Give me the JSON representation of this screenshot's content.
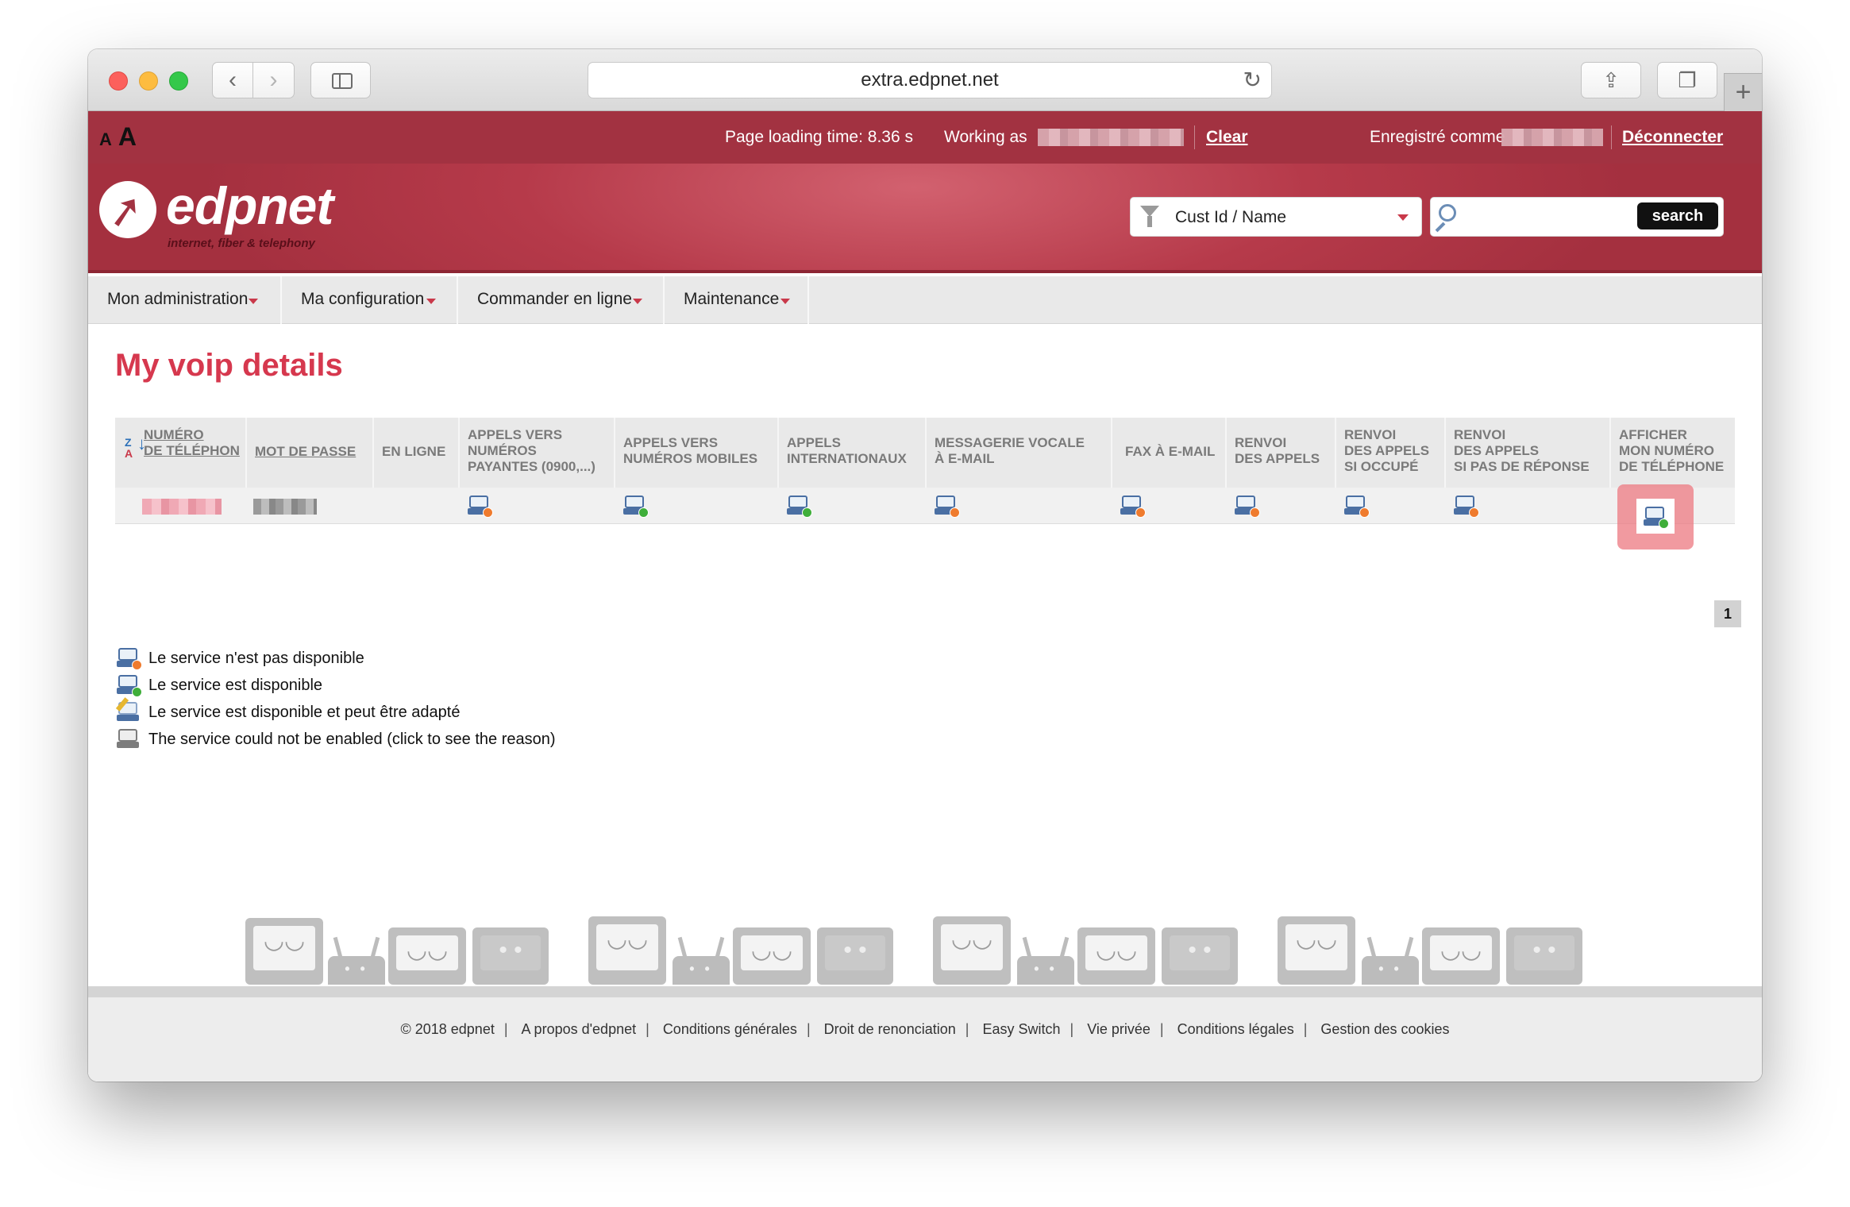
{
  "browser": {
    "url": "extra.edpnet.net",
    "back_icon": "chevron-left-icon",
    "forward_icon": "chevron-right-icon",
    "reload_icon": "reload-icon",
    "share_icon": "share-icon",
    "tabs_icon": "tabs-icon",
    "new_tab_symbol": "+"
  },
  "topbar": {
    "font_small": "A",
    "font_large": "A",
    "loading_time": "Page loading time: 8.36 s",
    "working_as_label": "Working as",
    "clear_link": "Clear",
    "registered_as_label": "Enregistré comme",
    "logout_link": "Déconnecter"
  },
  "brand": {
    "logo_text": "edpnet",
    "tagline": "internet, fiber & telephony",
    "filter_label": "Cust Id / Name",
    "search_placeholder": "",
    "search_button": "search"
  },
  "menu": [
    {
      "label": "Mon administration"
    },
    {
      "label": "Ma configuration"
    },
    {
      "label": "Commander en ligne"
    },
    {
      "label": "Maintenance"
    }
  ],
  "page": {
    "title": "My voip details",
    "pagination_current": "1"
  },
  "table": {
    "headers": [
      [
        "NUMÉRO",
        "DE TÉLÉPHON"
      ],
      [
        "MOT DE PASSE"
      ],
      [
        "EN LIGNE"
      ],
      [
        "APPELS VERS",
        "NUMÉROS",
        "PAYANTES (0900,...)"
      ],
      [
        "APPELS VERS",
        "NUMÉROS MOBILES"
      ],
      [
        "APPELS",
        "INTERNATIONAUX"
      ],
      [
        "MESSAGERIE VOCALE",
        "À E-MAIL"
      ],
      [
        "FAX À E-MAIL"
      ],
      [
        "RENVOI",
        "DES APPELS"
      ],
      [
        "RENVOI",
        "DES APPELS",
        "SI OCCUPÉ"
      ],
      [
        "RENVOI",
        "DES APPELS",
        "SI PAS DE RÉPONSE"
      ],
      [
        "AFFICHER",
        "MON NUMÉRO",
        "DE TÉLÉPHONE"
      ]
    ]
  },
  "legend": [
    {
      "text": "Le service n'est pas disponible",
      "icon": "service-unavailable-icon"
    },
    {
      "text": "Le service est disponible",
      "icon": "service-available-icon"
    },
    {
      "text": "Le service est disponible et peut être adapté",
      "icon": "service-editable-icon"
    },
    {
      "text": "The service could not be enabled (click to see the reason)",
      "icon": "service-error-icon"
    }
  ],
  "footer": [
    "© 2018 edpnet",
    "A propos d'edpnet",
    "Conditions générales",
    "Droit de renonciation",
    "Easy Switch",
    "Vie privée",
    "Conditions légales",
    "Gestion des cookies"
  ],
  "colors": {
    "brand_red": "#a23241",
    "title_red": "#d6384e",
    "highlight": "#ec7880"
  }
}
